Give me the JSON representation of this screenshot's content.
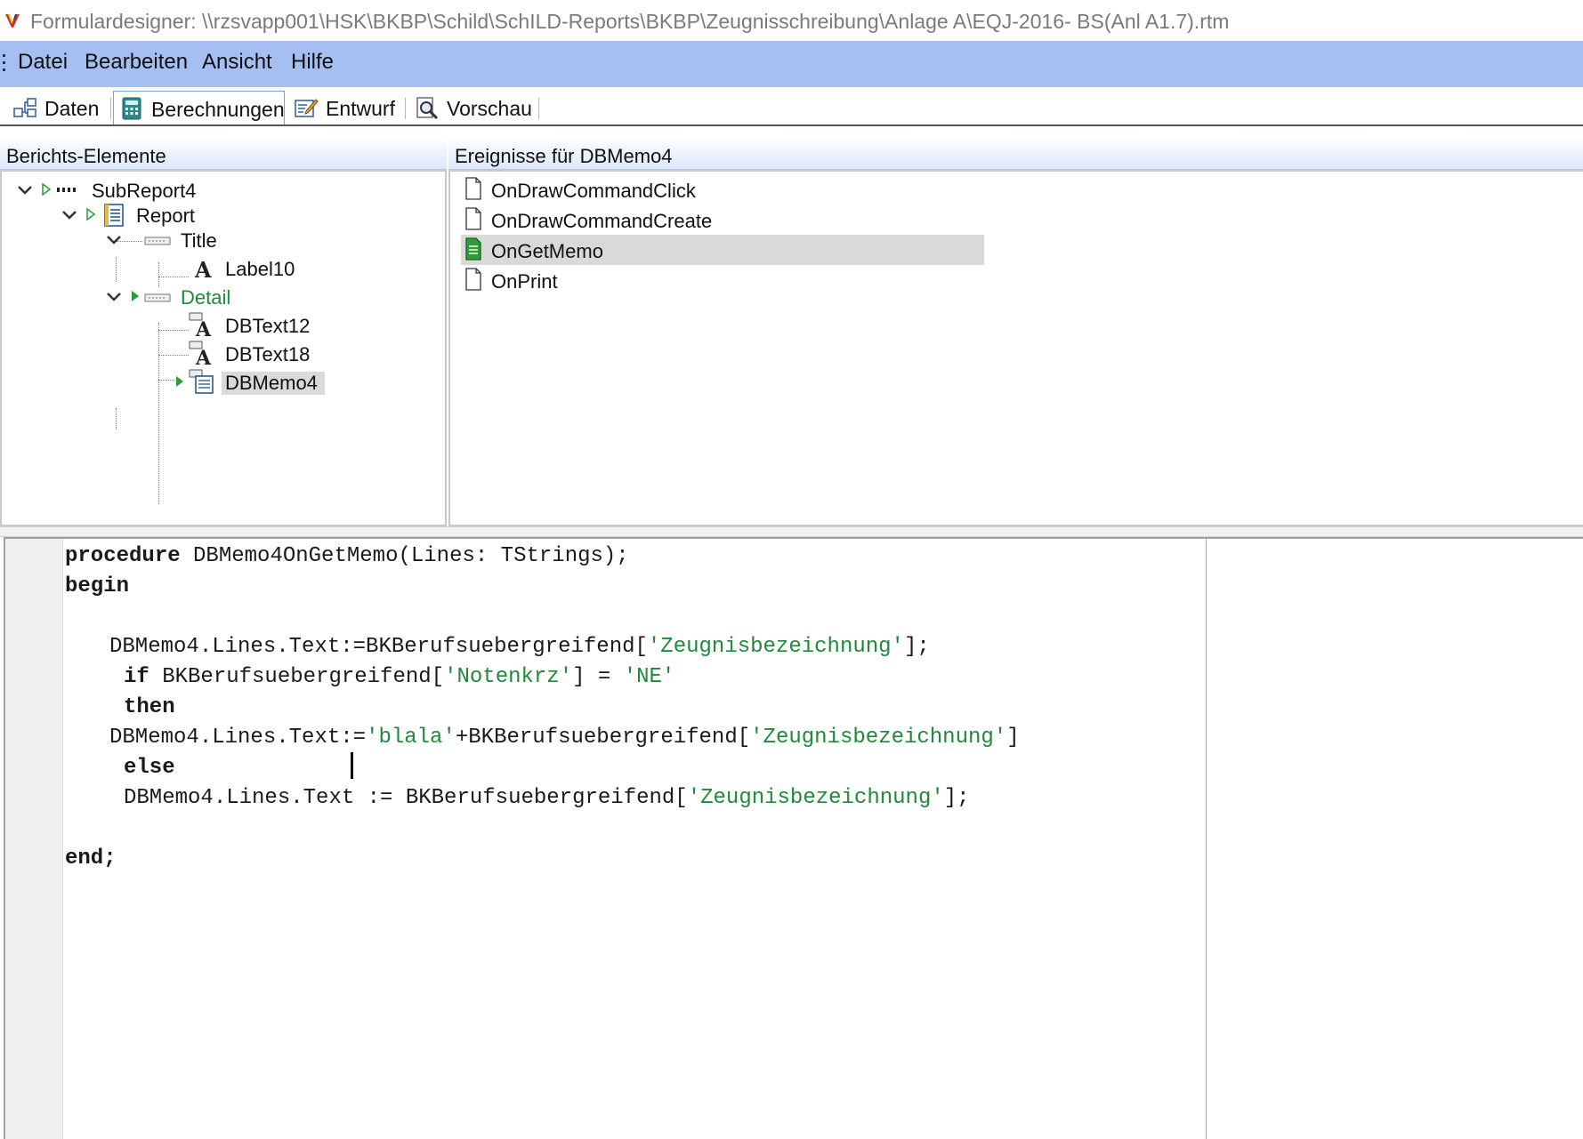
{
  "window": {
    "title": "Formulardesigner: \\\\rzsvapp001\\HSK\\BKBP\\Schild\\SchILD-Reports\\BKBP\\Zeugnisschreibung\\Anlage A\\EQJ-2016- BS(Anl A1.7).rtm"
  },
  "menu": {
    "items": [
      "Datei",
      "Bearbeiten",
      "Ansicht",
      "Hilfe"
    ]
  },
  "tabs": [
    {
      "label": "Daten",
      "icon": "data-tree-icon",
      "active": false
    },
    {
      "label": "Berechnungen",
      "icon": "calculator-icon",
      "active": true
    },
    {
      "label": "Entwurf",
      "icon": "pencil-form-icon",
      "active": false
    },
    {
      "label": "Vorschau",
      "icon": "magnifier-page-icon",
      "active": false
    }
  ],
  "left_panel": {
    "header": "Berichts-Elemente",
    "tree": [
      {
        "label": "SubReport4"
      },
      {
        "label": "Report"
      },
      {
        "label": "Title"
      },
      {
        "label": "Label10"
      },
      {
        "label": "Detail"
      },
      {
        "label": "DBText12"
      },
      {
        "label": "DBText18"
      },
      {
        "label": "DBMemo4"
      }
    ]
  },
  "right_panel": {
    "header": "Ereignisse für DBMemo4",
    "events": [
      {
        "label": "OnDrawCommandClick",
        "has_code": false
      },
      {
        "label": "OnDrawCommandCreate",
        "has_code": false
      },
      {
        "label": "OnGetMemo",
        "has_code": true
      },
      {
        "label": "OnPrint",
        "has_code": false
      }
    ]
  },
  "colors": {
    "menubar": "#a5bff2",
    "detail_green": "#1f8a3a",
    "string_green": "#1f8a3a",
    "selection_gray": "#d9d9d9"
  },
  "code": {
    "l1": {
      "kw": "procedure",
      "rest": " DBMemo4OnGetMemo(Lines: TStrings);"
    },
    "l2": {
      "kw": "begin"
    },
    "l4": {
      "a": "DBMemo4.Lines.Text:=BKBerufsuebergreifend[",
      "s1": "'Zeugnisbezeichnung'",
      "b": "];"
    },
    "l5": {
      "kw": "if",
      "a": " BKBerufsuebergreifend[",
      "s1": "'Notenkrz'",
      "b": "] = ",
      "s2": "'NE'"
    },
    "l6": {
      "kw": "then"
    },
    "l7": {
      "a": "DBMemo4.Lines.Text:=",
      "s1": "'blala'",
      "b": "+BKBerufsuebergreifend[",
      "s2": "'Zeugnisbezeichnung'",
      "c": "]"
    },
    "l8": {
      "kw": "else"
    },
    "l9": {
      "a": "DBMemo4.Lines.Text := BKBerufsuebergreifend[",
      "s1": "'Zeugnisbezeichnung'",
      "b": "];"
    },
    "l11": {
      "kw": "end;"
    }
  }
}
